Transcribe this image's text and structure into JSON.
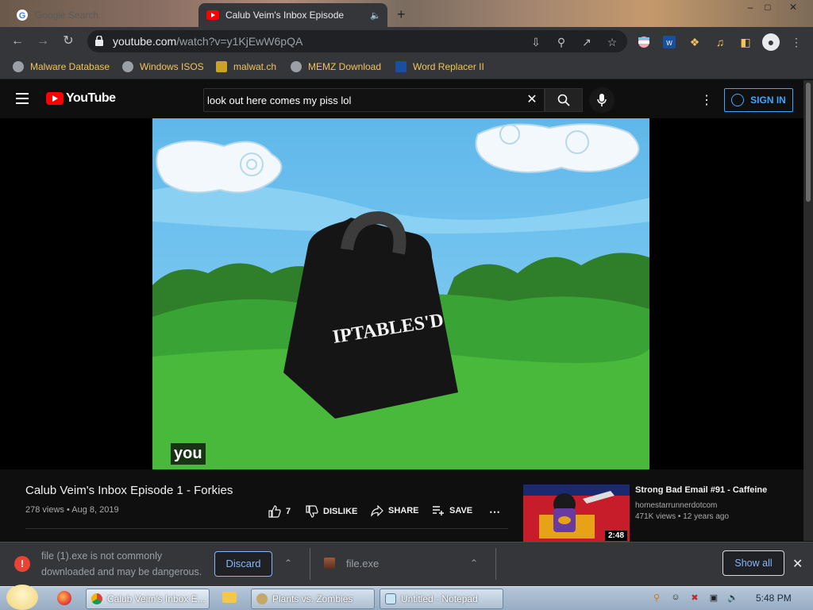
{
  "browser": {
    "tabs": [
      {
        "title": "Google Search",
        "active": false
      },
      {
        "title": "Calub Veim's Inbox Episode",
        "active": true
      }
    ],
    "address": {
      "host": "youtube.com",
      "path": "/watch?v=y1KjEwW6pQA"
    },
    "bookmarks": [
      {
        "label": "Malware Database"
      },
      {
        "label": "Windows ISOS"
      },
      {
        "label": "malwat.ch"
      },
      {
        "label": "MEMZ Download"
      },
      {
        "label": "Word Replacer II"
      }
    ],
    "accent": "#f3c25b"
  },
  "youtube": {
    "logo_text": "YouTube",
    "search_value": "look out here comes my piss lol",
    "signin_label": "SIGN IN",
    "video": {
      "weight_label": "IPTABLES'D",
      "caption": "you",
      "title": "Calub Veim's Inbox Episode 1 - Forkies",
      "views": "278 views",
      "date": "Aug 8, 2019",
      "likes": "7",
      "dislike_label": "DISLIKE",
      "share_label": "SHARE",
      "save_label": "SAVE"
    },
    "recommendation": {
      "title": "Strong Bad Email #91 - Caffeine",
      "channel": "homestarrunnerdotcom",
      "views": "471K views",
      "age": "12 years ago",
      "duration": "2:48"
    }
  },
  "download_bar": {
    "warning": "file (1).exe is not commonly downloaded and may be dangerous.",
    "discard_label": "Discard",
    "file_name": "file.exe",
    "show_all_label": "Show all"
  },
  "taskbar": {
    "apps": [
      {
        "label": "Calub Veim's Inbox E..."
      },
      {
        "label": "Plants vs. Zombies"
      },
      {
        "label": "Untitled - Notepad"
      }
    ],
    "clock": "5:48 PM"
  }
}
